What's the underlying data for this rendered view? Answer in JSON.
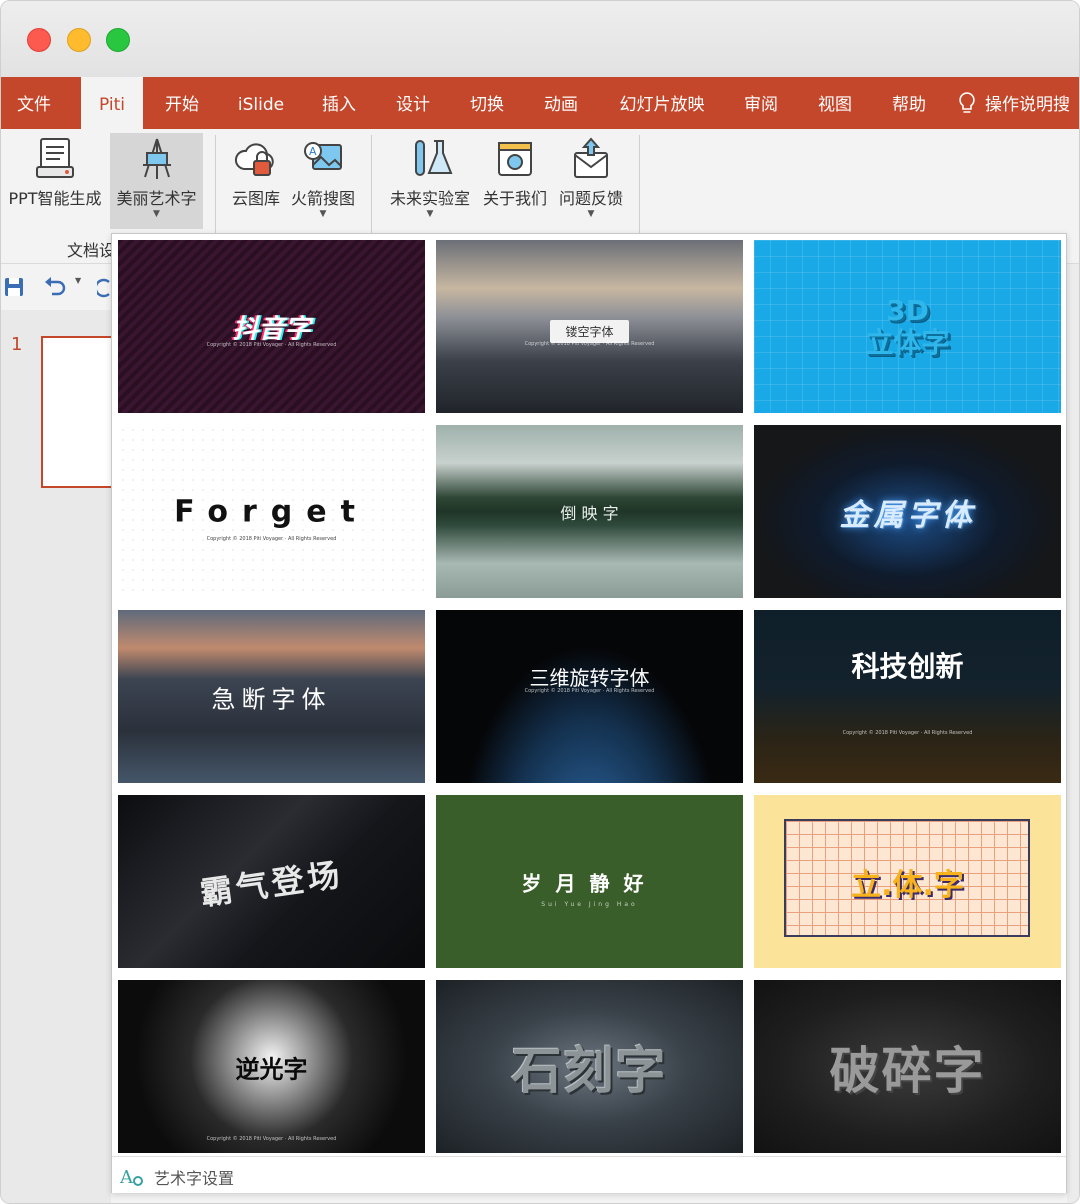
{
  "menubar": {
    "items": [
      {
        "label": "文件"
      },
      {
        "label": "Piti"
      },
      {
        "label": "开始"
      },
      {
        "label": "iSlide"
      },
      {
        "label": "插入"
      },
      {
        "label": "设计"
      },
      {
        "label": "切换"
      },
      {
        "label": "动画"
      },
      {
        "label": "幻灯片放映"
      },
      {
        "label": "审阅"
      },
      {
        "label": "视图"
      },
      {
        "label": "帮助"
      }
    ],
    "active": "Piti",
    "tell_me": "操作说明搜",
    "accent_color": "#c4472b"
  },
  "ribbon": {
    "buttons": [
      {
        "label": "PPT智能生成",
        "icon": "document-list-icon"
      },
      {
        "label": "美丽艺术字",
        "icon": "easel-art-icon"
      },
      {
        "label": "云图库",
        "icon": "cloud-lock-icon"
      },
      {
        "label": "火箭搜图",
        "icon": "image-search-icon"
      },
      {
        "label": "未来实验室",
        "icon": "lab-flask-icon"
      },
      {
        "label": "关于我们",
        "icon": "about-us-icon"
      },
      {
        "label": "问题反馈",
        "icon": "feedback-mail-icon"
      }
    ],
    "group_label": "文档设"
  },
  "slides": {
    "number": "1"
  },
  "gallery": {
    "tiles": [
      {
        "text": "抖音字",
        "sub": "Copyright © 2018 Piti Voyager · All Rights Reserved"
      },
      {
        "text": "镂空字体",
        "sub": "Copyright © 2018 Piti Voyager · All Rights Reserved"
      },
      {
        "text": "3D\n立体字",
        "sub": ""
      },
      {
        "text": "Forget",
        "sub": "Copyright © 2018 Piti Voyager · All Rights Reserved"
      },
      {
        "text": "倒  映  字",
        "sub": ""
      },
      {
        "text": "金属字体",
        "sub": ""
      },
      {
        "text": "急断字体",
        "sub": ""
      },
      {
        "text": "三维旋转字体",
        "sub": "Copyright © 2018 Piti Voyager · All Rights Reserved"
      },
      {
        "text": "科技创新",
        "sub": "Copyright © 2018 Piti Voyager · All Rights Reserved"
      },
      {
        "text": "霸气登场",
        "sub": ""
      },
      {
        "text": "岁月静好",
        "sub": "Sui  Yue  Jing  Hao"
      },
      {
        "text": "立.体.字",
        "sub": ""
      },
      {
        "text": "逆光字",
        "sub": "Copyright © 2018 Piti Voyager · All Rights Reserved"
      },
      {
        "text": "石刻字",
        "sub": ""
      },
      {
        "text": "破碎字",
        "sub": ""
      }
    ],
    "footer_label": "艺术字设置"
  }
}
